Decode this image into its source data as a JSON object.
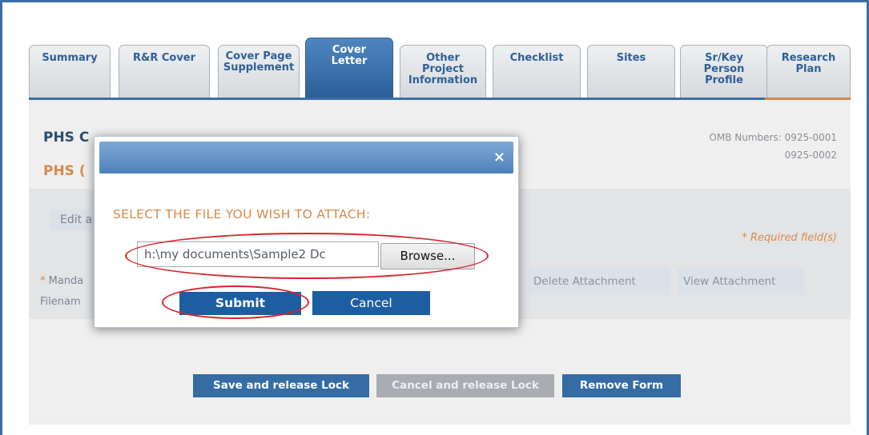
{
  "tabs": [
    {
      "label": "Summary"
    },
    {
      "label": "R&R Cover"
    },
    {
      "label": "Cover Page Supplement"
    },
    {
      "label": "Cover Letter"
    },
    {
      "label": "Other Project Information"
    },
    {
      "label": "Checklist"
    },
    {
      "label": "Sites"
    },
    {
      "label": "Sr/Key Person Profile"
    },
    {
      "label": "Research Plan"
    }
  ],
  "form": {
    "title": "PHS C",
    "subtitle": "PHS (",
    "omb_line1": "OMB Numbers: 0925-0001",
    "omb_line2": "0925-0002",
    "edit_button": "Edit a",
    "required_note": "* Required field(s)",
    "mandatory_star": "*",
    "mandatory_label": " Manda",
    "filename_label": "Filenam",
    "delete_attachment": "Delete Attachment",
    "view_attachment": "View Attachment"
  },
  "footer": {
    "save_release": "Save and release Lock",
    "cancel_release": "Cancel and release Lock",
    "remove_form": "Remove Form"
  },
  "modal": {
    "close_glyph": "×",
    "label": "SELECT THE FILE YOU WISH TO ATTACH:",
    "file_value": "h:\\my documents\\Sample2 Dc",
    "browse": "Browse...",
    "submit": "Submit",
    "cancel": "Cancel"
  },
  "colors": {
    "tab_active": "#2c5f98",
    "accent_orange": "#d9884a",
    "button_blue": "#1d5ea3",
    "highlight_red": "#d8232a"
  }
}
